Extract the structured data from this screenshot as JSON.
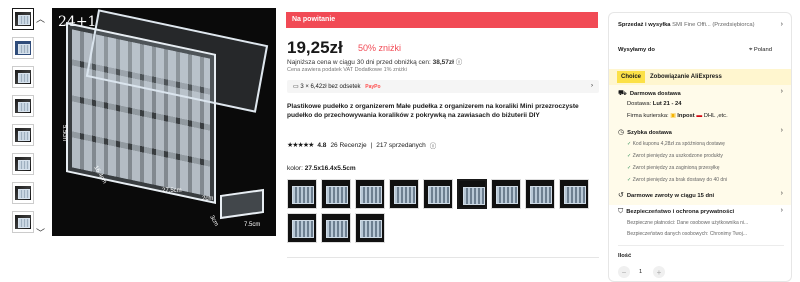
{
  "gallery": {
    "badge": "24+1",
    "dim_labels": [
      "27.5cm",
      "16.4cm",
      "5.5cm",
      "2cm",
      "3cm",
      "7.5cm"
    ]
  },
  "promo": {
    "label": "Na powitanie"
  },
  "price": {
    "current": "19,25zł",
    "discount": "50% zniżki",
    "lowest_prefix": "Najniższa cena w ciągu 30 dni przed obniżką cen:",
    "lowest_value": "38,57zł",
    "vat_note": "Cena zawiera podatek VAT Dodatkowe 1% zniżki"
  },
  "installments": {
    "text": "3 × 6,42zł bez odsetek",
    "provider": "PayPo",
    "chevron": "›"
  },
  "product": {
    "title": "Plastikowe pudełko z organizerem Małe pudełka z organizerem na koraliki Mini przezroczyste pudełko do przechowywania koralików z pokrywką na zawiasach do biżuterii DIY",
    "rating": "4.8",
    "reviews": "26 Recenzje",
    "sold": "217 sprzedanych"
  },
  "color": {
    "label": "kolor:",
    "value": "27.5x16.4x5.5cm",
    "swatch_count": 12,
    "selected_index": 5
  },
  "seller": {
    "label": "Sprzedaż i wysyłka",
    "value": "SMI Fine Offi... (Przedsiębiorca)"
  },
  "ship_to": {
    "label": "Wysyłamy do",
    "country": "Poland"
  },
  "choice": {
    "tag": "Choice",
    "text": "Zobowiązanie AliExpress"
  },
  "delivery": {
    "title": "Darmowa dostawa",
    "date_label": "Dostawa:",
    "date": "Lut 21 - 24",
    "courier_label": "Firma kurierska:",
    "courier_a": "Inpost",
    "courier_b": "DHL ,etc."
  },
  "fast": {
    "title": "Szybka dostawa",
    "items": [
      "Kod kuponu 4,28zł za spóźnioną dostawę",
      "Zwrot pieniędzy za uszkodzone produkty",
      "Zwrot pieniędzy za zaginioną przesyłkę",
      "Zwrot pieniędzy za brak dostawy do 40 dni"
    ]
  },
  "returns": {
    "text": "Darmowe zwroty w ciągu 15 dni"
  },
  "security": {
    "title": "Bezpieczeństwo i ochrona prywatności",
    "line1": "Bezpieczne płatności: Dane osobowe użytkownika ni...",
    "line2": "Bezpieczeństwo danych osobowych: Chronimy Twoj..."
  },
  "quantity": {
    "label": "Ilość",
    "value": "1"
  }
}
